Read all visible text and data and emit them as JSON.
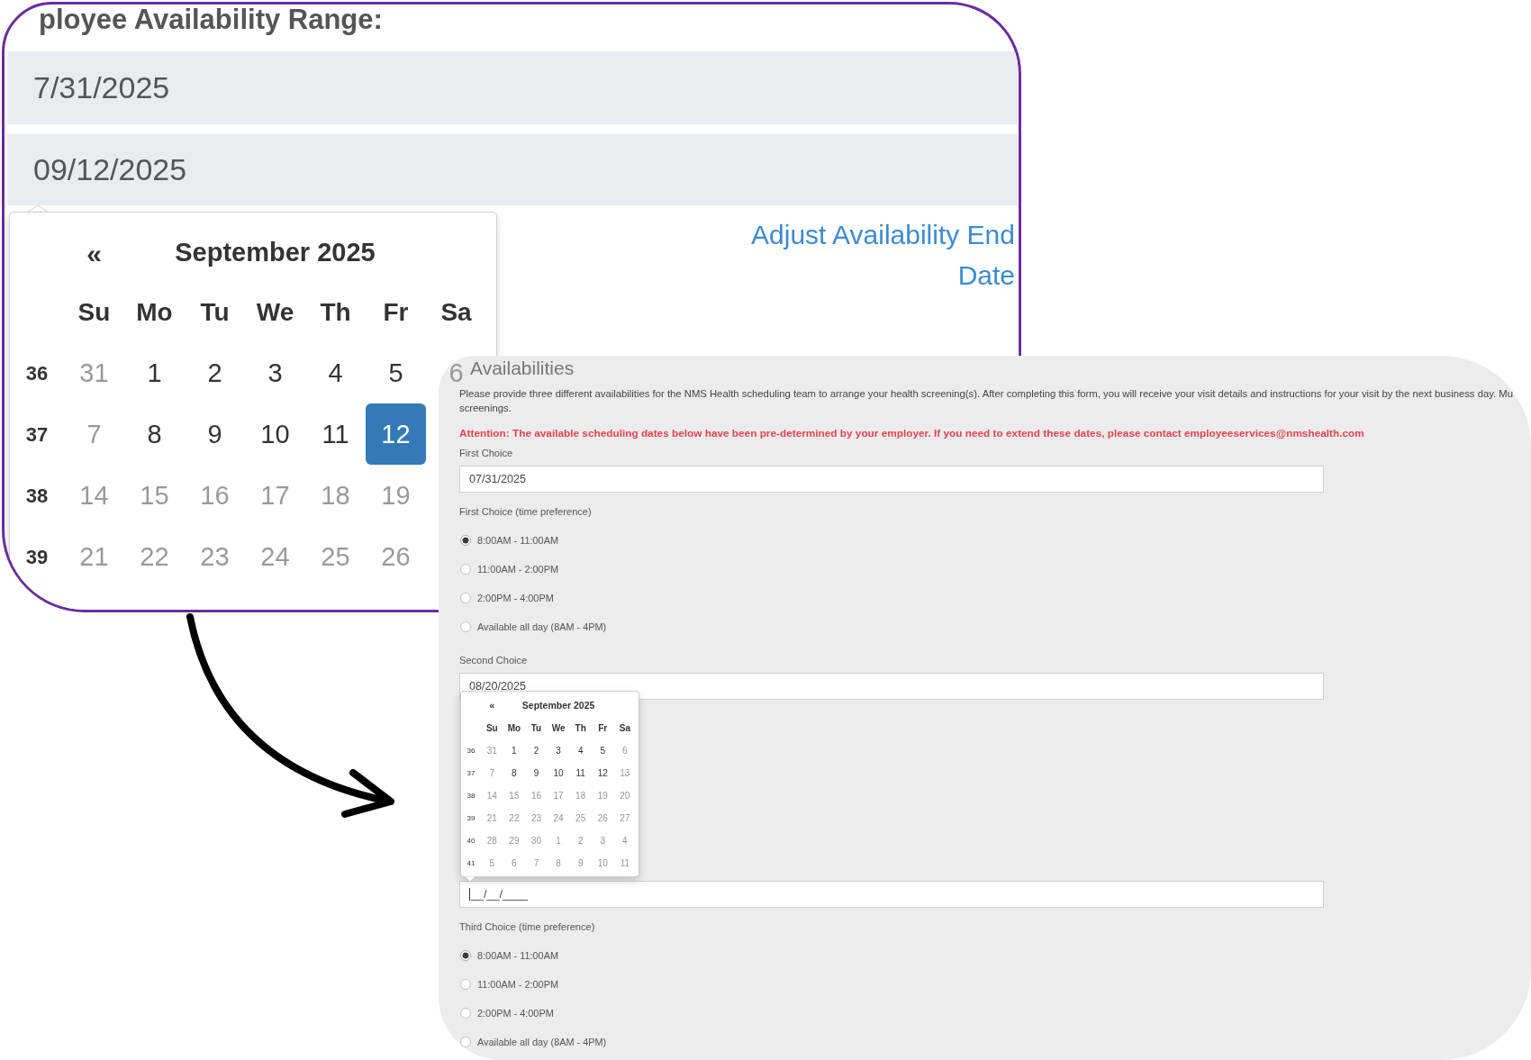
{
  "inset": {
    "heading": "ployee Availability Range:",
    "range_fields": [
      {
        "value": "7/31/2025"
      },
      {
        "value": "09/12/2025"
      }
    ],
    "datepicker": {
      "prev": "«",
      "title": "September 2025",
      "weekdays": [
        "Su",
        "Mo",
        "Tu",
        "We",
        "Th",
        "Fr",
        "Sa"
      ],
      "weeks": [
        {
          "number": "36",
          "days": [
            {
              "label": "31",
              "disabled": true,
              "selected": false
            },
            {
              "label": "1",
              "disabled": false,
              "selected": false
            },
            {
              "label": "2",
              "disabled": false,
              "selected": false
            },
            {
              "label": "3",
              "disabled": false,
              "selected": false
            },
            {
              "label": "4",
              "disabled": false,
              "selected": false
            },
            {
              "label": "5",
              "disabled": false,
              "selected": false
            },
            {
              "label": "6",
              "disabled": true,
              "selected": false
            }
          ]
        },
        {
          "number": "37",
          "days": [
            {
              "label": "7",
              "disabled": true,
              "selected": false
            },
            {
              "label": "8",
              "disabled": false,
              "selected": false
            },
            {
              "label": "9",
              "disabled": false,
              "selected": false
            },
            {
              "label": "10",
              "disabled": false,
              "selected": false
            },
            {
              "label": "11",
              "disabled": false,
              "selected": false
            },
            {
              "label": "12",
              "disabled": false,
              "selected": true
            }
          ]
        },
        {
          "number": "38",
          "days": [
            {
              "label": "14",
              "disabled": true,
              "selected": false
            },
            {
              "label": "15",
              "disabled": true,
              "selected": false
            },
            {
              "label": "16",
              "disabled": true,
              "selected": false
            },
            {
              "label": "17",
              "disabled": true,
              "selected": false
            },
            {
              "label": "18",
              "disabled": true,
              "selected": false
            },
            {
              "label": "19",
              "disabled": true,
              "selected": false
            }
          ]
        },
        {
          "number": "39",
          "days": [
            {
              "label": "21",
              "disabled": true,
              "selected": false
            },
            {
              "label": "22",
              "disabled": true,
              "selected": false
            },
            {
              "label": "23",
              "disabled": true,
              "selected": false
            },
            {
              "label": "24",
              "disabled": true,
              "selected": false
            },
            {
              "label": "25",
              "disabled": true,
              "selected": false
            },
            {
              "label": "26",
              "disabled": true,
              "selected": false
            }
          ]
        }
      ]
    },
    "link": "Adjust Availability End Date"
  },
  "form": {
    "title": "Availabilities",
    "intro_lines": [
      "Please provide three different availabilities for the NMS Health scheduling team to arrange your health screening(s). After completing this form, you will receive your visit details and instructions for your visit by the next business day. Mu",
      "screenings."
    ],
    "attention": "Attention: The available scheduling dates below have been pre-determined by your employer. If you need to extend these dates, please contact employeeservices@nmshealth.com",
    "items": [
      {
        "kind": "label",
        "text": "First Choice"
      },
      {
        "kind": "date",
        "value": "07/31/2025",
        "focused": false
      },
      {
        "kind": "label",
        "text": "First Choice (time preference)"
      },
      {
        "kind": "radios",
        "options": [
          {
            "label": "8:00AM - 11:00AM",
            "selected": true
          },
          {
            "label": "11:00AM - 2:00PM",
            "selected": false
          },
          {
            "label": "2:00PM - 4:00PM",
            "selected": false
          },
          {
            "label": "Available all day (8AM - 4PM)",
            "selected": false
          }
        ]
      },
      {
        "kind": "label",
        "text": "Second Choice"
      },
      {
        "kind": "date",
        "value": "08/20/2025",
        "focused": false
      },
      {
        "kind": "date",
        "value": "__/__/____",
        "focused": true,
        "datepicker": {
          "prev": "«",
          "title": "September 2025",
          "weekdays": [
            "Su",
            "Mo",
            "Tu",
            "We",
            "Th",
            "Fr",
            "Sa"
          ],
          "weeks": [
            {
              "number": "36",
              "days": [
                {
                  "label": "31",
                  "disabled": true,
                  "selected": false
                },
                {
                  "label": "1",
                  "disabled": false,
                  "selected": false
                },
                {
                  "label": "2",
                  "disabled": false,
                  "selected": false
                },
                {
                  "label": "3",
                  "disabled": false,
                  "selected": false
                },
                {
                  "label": "4",
                  "disabled": false,
                  "selected": false
                },
                {
                  "label": "5",
                  "disabled": false,
                  "selected": false
                },
                {
                  "label": "6",
                  "disabled": true,
                  "selected": false
                }
              ]
            },
            {
              "number": "37",
              "days": [
                {
                  "label": "7",
                  "disabled": true,
                  "selected": false
                },
                {
                  "label": "8",
                  "disabled": false,
                  "selected": false
                },
                {
                  "label": "9",
                  "disabled": false,
                  "selected": false
                },
                {
                  "label": "10",
                  "disabled": false,
                  "selected": false
                },
                {
                  "label": "11",
                  "disabled": false,
                  "selected": false
                },
                {
                  "label": "12",
                  "disabled": false,
                  "selected": false
                },
                {
                  "label": "13",
                  "disabled": true,
                  "selected": false
                }
              ]
            },
            {
              "number": "38",
              "days": [
                {
                  "label": "14",
                  "disabled": true,
                  "selected": false
                },
                {
                  "label": "15",
                  "disabled": true,
                  "selected": false
                },
                {
                  "label": "16",
                  "disabled": true,
                  "selected": false
                },
                {
                  "label": "17",
                  "disabled": true,
                  "selected": false
                },
                {
                  "label": "18",
                  "disabled": true,
                  "selected": false
                },
                {
                  "label": "19",
                  "disabled": true,
                  "selected": false
                },
                {
                  "label": "20",
                  "disabled": true,
                  "selected": false
                }
              ]
            },
            {
              "number": "39",
              "days": [
                {
                  "label": "21",
                  "disabled": true,
                  "selected": false
                },
                {
                  "label": "22",
                  "disabled": true,
                  "selected": false
                },
                {
                  "label": "23",
                  "disabled": true,
                  "selected": false
                },
                {
                  "label": "24",
                  "disabled": true,
                  "selected": false
                },
                {
                  "label": "25",
                  "disabled": true,
                  "selected": false
                },
                {
                  "label": "26",
                  "disabled": true,
                  "selected": false
                },
                {
                  "label": "27",
                  "disabled": true,
                  "selected": false
                }
              ]
            },
            {
              "number": "40",
              "days": [
                {
                  "label": "28",
                  "disabled": true,
                  "selected": false
                },
                {
                  "label": "29",
                  "disabled": true,
                  "selected": false
                },
                {
                  "label": "30",
                  "disabled": true,
                  "selected": false
                },
                {
                  "label": "1",
                  "disabled": true,
                  "selected": false
                },
                {
                  "label": "2",
                  "disabled": true,
                  "selected": false
                },
                {
                  "label": "3",
                  "disabled": true,
                  "selected": false
                },
                {
                  "label": "4",
                  "disabled": true,
                  "selected": false
                }
              ]
            },
            {
              "number": "41",
              "days": [
                {
                  "label": "5",
                  "disabled": true,
                  "selected": false
                },
                {
                  "label": "6",
                  "disabled": true,
                  "selected": false
                },
                {
                  "label": "7",
                  "disabled": true,
                  "selected": false
                },
                {
                  "label": "8",
                  "disabled": true,
                  "selected": false
                },
                {
                  "label": "9",
                  "disabled": true,
                  "selected": false
                },
                {
                  "label": "10",
                  "disabled": true,
                  "selected": false
                },
                {
                  "label": "11",
                  "disabled": true,
                  "selected": false
                }
              ]
            }
          ]
        }
      },
      {
        "kind": "label",
        "text": "Third Choice (time preference)"
      },
      {
        "kind": "radios",
        "options": [
          {
            "label": "8:00AM - 11:00AM",
            "selected": true
          },
          {
            "label": "11:00AM - 2:00PM",
            "selected": false
          },
          {
            "label": "2:00PM - 4:00PM",
            "selected": false
          },
          {
            "label": "Available all day (8AM - 4PM)",
            "selected": false
          }
        ]
      }
    ]
  }
}
